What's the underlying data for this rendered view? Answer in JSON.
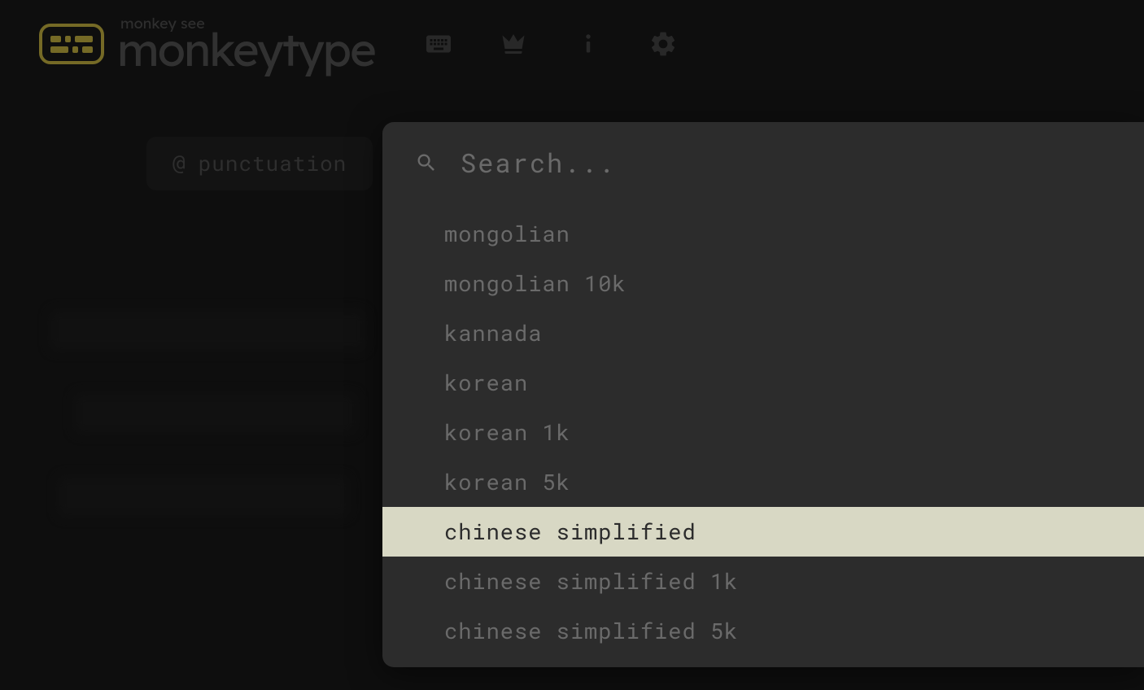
{
  "header": {
    "tagline": "monkey see",
    "title": "monkeytype"
  },
  "config": {
    "at": "@",
    "punctuation_label": "punctuation"
  },
  "search": {
    "placeholder": "Search..."
  },
  "languages": [
    "mongolian",
    "mongolian 10k",
    "kannada",
    "korean",
    "korean 1k",
    "korean 5k",
    "chinese simplified",
    "chinese simplified 1k",
    "chinese simplified 5k"
  ],
  "active_index": 6
}
